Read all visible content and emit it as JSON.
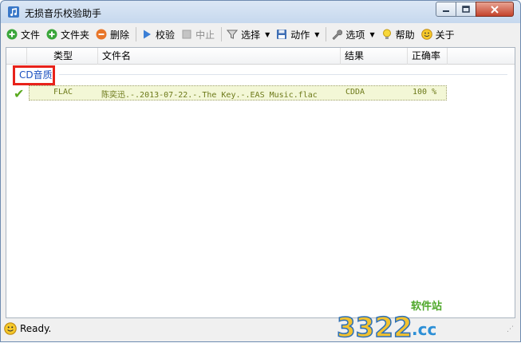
{
  "window": {
    "title": "无损音乐校验助手"
  },
  "toolbar": {
    "file": "文件",
    "folder": "文件夹",
    "delete": "删除",
    "verify": "校验",
    "stop": "中止",
    "select": "选择",
    "action": "动作",
    "options": "选项",
    "help": "帮助",
    "about": "关于"
  },
  "columns": [
    "类型",
    "文件名",
    "结果",
    "正确率"
  ],
  "group": {
    "label": "CD音质"
  },
  "rows": [
    {
      "type": "FLAC",
      "filename": "陈奕迅.-.2013-07-22.-.The Key.-.EAS Music.flac",
      "result": "CDDA",
      "accuracy": "100 %"
    }
  ],
  "status": {
    "text": "Ready."
  },
  "watermark": {
    "number": "3322",
    "domain": ".cc",
    "label": "软件站"
  },
  "colors": {
    "group_highlight": "#e8221a",
    "group_label": "#1c52c0",
    "row_bg": "#f3f7d6",
    "check": "#5aaa20"
  }
}
